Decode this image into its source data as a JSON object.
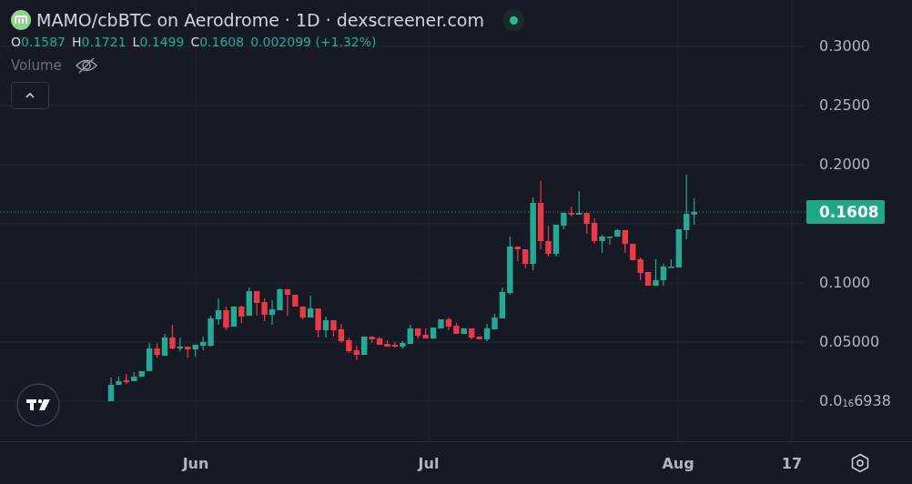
{
  "header": {
    "title": "MAMO/cbBTC on Aerodrome · 1D · dexscreener.com",
    "live": true
  },
  "legend": {
    "ohlc": [
      {
        "key": "O",
        "value": "0.1587"
      },
      {
        "key": "H",
        "value": "0.1721"
      },
      {
        "key": "L",
        "value": "0.1499"
      },
      {
        "key": "C",
        "value": "0.1608"
      }
    ],
    "change": "0.002099 (+1.32%)"
  },
  "volume": {
    "label": "Volume",
    "visible": false
  },
  "chart": {
    "last_price_tag": "0.1608",
    "price_axis_labels": [
      "0.3000",
      "0.2500",
      "0.2000",
      "0.1000",
      "0.05000",
      "0.0$_{16}$6938"
    ],
    "time_axis_labels": [
      "Jun",
      "Jul",
      "Aug",
      "17"
    ]
  }
}
